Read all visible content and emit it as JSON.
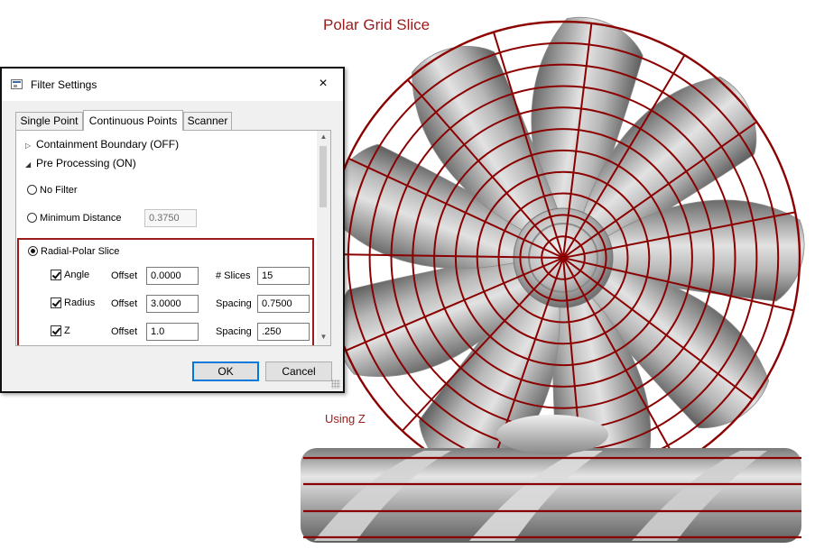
{
  "annotations": {
    "title": "Polar Grid Slice",
    "using_z": "Using Z"
  },
  "colors": {
    "annotation": "#9b1b1b",
    "grid": "#8b0000",
    "focus_blue": "#0078d7"
  },
  "dialog": {
    "title": "Filter Settings",
    "close_icon": "×",
    "tabs": [
      {
        "label": "Single Point",
        "active": false
      },
      {
        "label": "Continuous Points",
        "active": true
      },
      {
        "label": "Scanner",
        "active": false
      }
    ],
    "tree": [
      {
        "label": "Containment Boundary (OFF)",
        "expanded": false
      },
      {
        "label": "Pre Processing (ON)",
        "expanded": true
      }
    ],
    "options": {
      "no_filter": "No Filter",
      "min_distance": "Minimum Distance",
      "min_distance_value": "0.3750",
      "radial_polar": "Radial-Polar Slice"
    },
    "rows": [
      {
        "check_label": "Angle",
        "offset_label": "Offset",
        "offset": "0.0000",
        "right_label": "# Slices",
        "right_value": "15"
      },
      {
        "check_label": "Radius",
        "offset_label": "Offset",
        "offset": "3.0000",
        "right_label": "Spacing",
        "right_value": "0.7500"
      },
      {
        "check_label": "Z",
        "offset_label": "Offset",
        "offset": "1.0",
        "right_label": "Spacing",
        "right_value": ".250"
      }
    ],
    "ok": "OK",
    "cancel": "Cancel"
  }
}
